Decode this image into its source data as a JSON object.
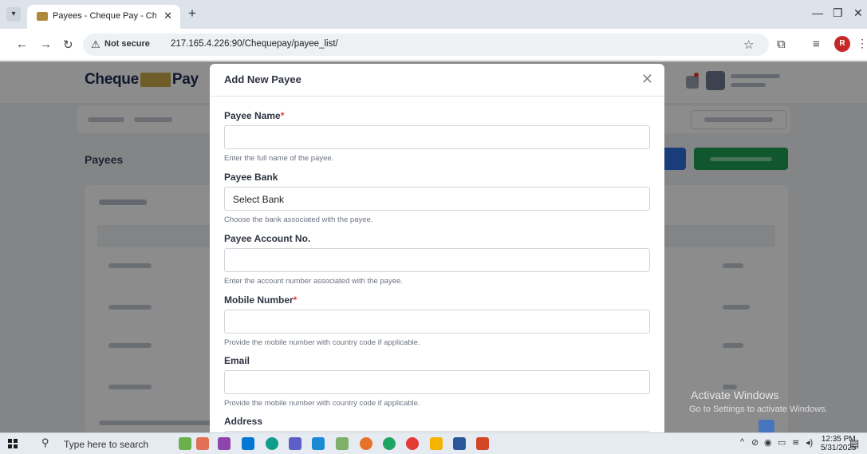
{
  "browser": {
    "tab_title": "Payees - Cheque Pay - Cheque",
    "tab_menu_icon": "chevron-down-icon",
    "new_tab_icon": "plus-icon",
    "security_label": "Not secure",
    "url": "217.165.4.226:90/Chequepay/payee_list/",
    "profile_initial": "R"
  },
  "page": {
    "brand_left": "Cheque",
    "brand_right": "Pay",
    "section_title": "Payees"
  },
  "modal": {
    "title": "Add New Payee",
    "fields": [
      {
        "label": "Payee Name",
        "required": "*",
        "value": "",
        "help": "Enter the full name of the payee."
      },
      {
        "label": "Payee Bank",
        "required": "",
        "selected": "Select Bank",
        "help": "Choose the bank associated with the payee."
      },
      {
        "label": "Payee Account No.",
        "required": "",
        "value": "",
        "help": "Enter the account number associated with the payee."
      },
      {
        "label": "Mobile Number",
        "required": "*",
        "value": "",
        "help": "Provide the mobile number with country code if applicable."
      },
      {
        "label": "Email",
        "required": "",
        "value": "",
        "help": "Provide the mobile number with country code if applicable."
      },
      {
        "label": "Address",
        "required": "",
        "value": ""
      }
    ]
  },
  "watermark": {
    "line1": "Activate Windows",
    "line2": "Go to Settings to activate Windows."
  },
  "taskbar": {
    "search_placeholder": "Type here to search",
    "time": "12:35 PM",
    "date": "5/31/2025"
  },
  "colors": {
    "accent_blue": "#2f6fe0",
    "accent_green": "#1e9e52",
    "required_red": "#e53935",
    "profile_red": "#c62828"
  }
}
